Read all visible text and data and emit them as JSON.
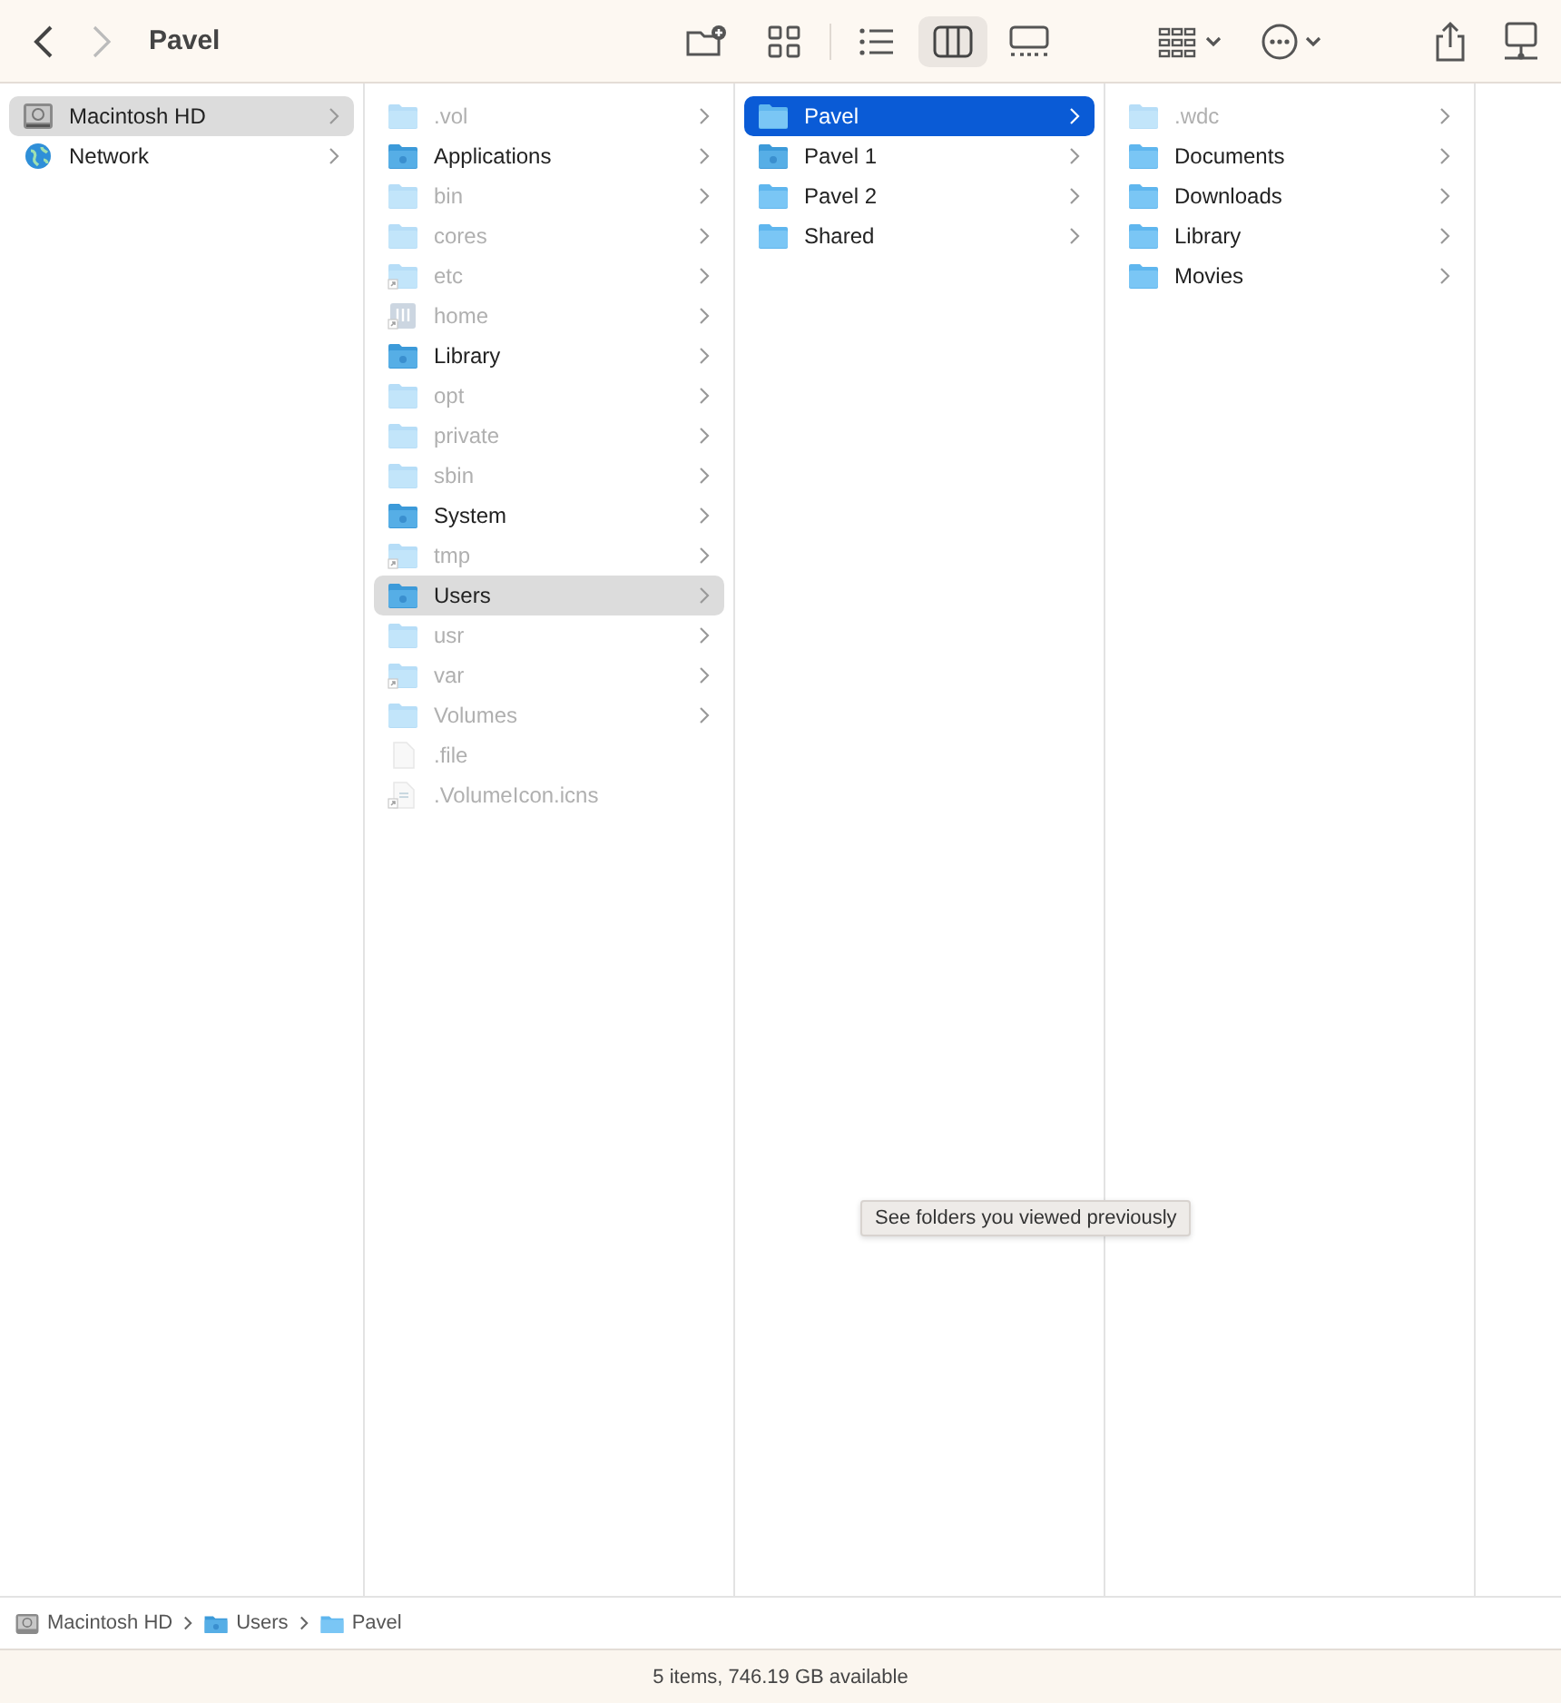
{
  "window": {
    "title": "Pavel"
  },
  "toolbar": {
    "back_enabled": true,
    "forward_enabled": false,
    "view_modes": [
      {
        "kind": "icons",
        "selected": false
      },
      {
        "kind": "list",
        "selected": false
      },
      {
        "kind": "columns",
        "selected": true
      },
      {
        "kind": "gallery",
        "selected": false
      }
    ]
  },
  "columns": [
    {
      "active": false,
      "items": [
        {
          "name": "Macintosh HD",
          "kind": "drive",
          "dimmed": false,
          "alias": false,
          "expandable": true,
          "selected": true
        },
        {
          "name": "Network",
          "kind": "globe",
          "dimmed": false,
          "alias": false,
          "expandable": true,
          "selected": false
        }
      ]
    },
    {
      "active": false,
      "items": [
        {
          "name": ".vol",
          "kind": "folder",
          "dimmed": true,
          "alias": false,
          "expandable": true,
          "selected": false
        },
        {
          "name": "Applications",
          "kind": "special-folder",
          "dimmed": false,
          "alias": false,
          "expandable": true,
          "selected": false
        },
        {
          "name": "bin",
          "kind": "folder",
          "dimmed": true,
          "alias": false,
          "expandable": true,
          "selected": false
        },
        {
          "name": "cores",
          "kind": "folder",
          "dimmed": true,
          "alias": false,
          "expandable": true,
          "selected": false
        },
        {
          "name": "etc",
          "kind": "folder",
          "dimmed": true,
          "alias": true,
          "expandable": true,
          "selected": false
        },
        {
          "name": "home",
          "kind": "server",
          "dimmed": true,
          "alias": true,
          "expandable": true,
          "selected": false
        },
        {
          "name": "Library",
          "kind": "special-folder",
          "dimmed": false,
          "alias": false,
          "expandable": true,
          "selected": false
        },
        {
          "name": "opt",
          "kind": "folder",
          "dimmed": true,
          "alias": false,
          "expandable": true,
          "selected": false
        },
        {
          "name": "private",
          "kind": "folder",
          "dimmed": true,
          "alias": false,
          "expandable": true,
          "selected": false
        },
        {
          "name": "sbin",
          "kind": "folder",
          "dimmed": true,
          "alias": false,
          "expandable": true,
          "selected": false
        },
        {
          "name": "System",
          "kind": "special-folder",
          "dimmed": false,
          "alias": false,
          "expandable": true,
          "selected": false
        },
        {
          "name": "tmp",
          "kind": "folder",
          "dimmed": true,
          "alias": true,
          "expandable": true,
          "selected": false
        },
        {
          "name": "Users",
          "kind": "special-folder",
          "dimmed": false,
          "alias": false,
          "expandable": true,
          "selected": true
        },
        {
          "name": "usr",
          "kind": "folder",
          "dimmed": true,
          "alias": false,
          "expandable": true,
          "selected": false
        },
        {
          "name": "var",
          "kind": "folder",
          "dimmed": true,
          "alias": true,
          "expandable": true,
          "selected": false
        },
        {
          "name": "Volumes",
          "kind": "folder",
          "dimmed": true,
          "alias": false,
          "expandable": true,
          "selected": false
        },
        {
          "name": ".file",
          "kind": "file",
          "dimmed": true,
          "alias": false,
          "expandable": false,
          "selected": false
        },
        {
          "name": ".VolumeIcon.icns",
          "kind": "file",
          "dimmed": true,
          "alias": true,
          "expandable": false,
          "selected": false
        }
      ]
    },
    {
      "active": true,
      "items": [
        {
          "name": "Pavel",
          "kind": "folder",
          "dimmed": false,
          "alias": false,
          "expandable": true,
          "selected": true
        },
        {
          "name": "Pavel 1",
          "kind": "special-folder",
          "dimmed": false,
          "alias": false,
          "expandable": true,
          "selected": false
        },
        {
          "name": "Pavel 2",
          "kind": "folder",
          "dimmed": false,
          "alias": false,
          "expandable": true,
          "selected": false
        },
        {
          "name": "Shared",
          "kind": "folder",
          "dimmed": false,
          "alias": false,
          "expandable": true,
          "selected": false
        }
      ]
    },
    {
      "items": [
        {
          "name": ".wdc",
          "kind": "folder",
          "dimmed": true,
          "alias": false,
          "expandable": true,
          "selected": false
        },
        {
          "name": "Documents",
          "kind": "folder",
          "dimmed": false,
          "alias": false,
          "expandable": true,
          "selected": false
        },
        {
          "name": "Downloads",
          "kind": "folder",
          "dimmed": false,
          "alias": false,
          "expandable": true,
          "selected": false
        },
        {
          "name": "Library",
          "kind": "folder",
          "dimmed": false,
          "alias": false,
          "expandable": true,
          "selected": false
        },
        {
          "name": "Movies",
          "kind": "folder",
          "dimmed": false,
          "alias": false,
          "expandable": true,
          "selected": false
        }
      ]
    }
  ],
  "tooltip": "See folders you viewed previously",
  "path_bar": [
    {
      "name": "Macintosh HD",
      "kind": "drive"
    },
    {
      "name": "Users",
      "kind": "special-folder"
    },
    {
      "name": "Pavel",
      "kind": "folder"
    }
  ],
  "status_bar": "5 items, 746.19 GB available"
}
